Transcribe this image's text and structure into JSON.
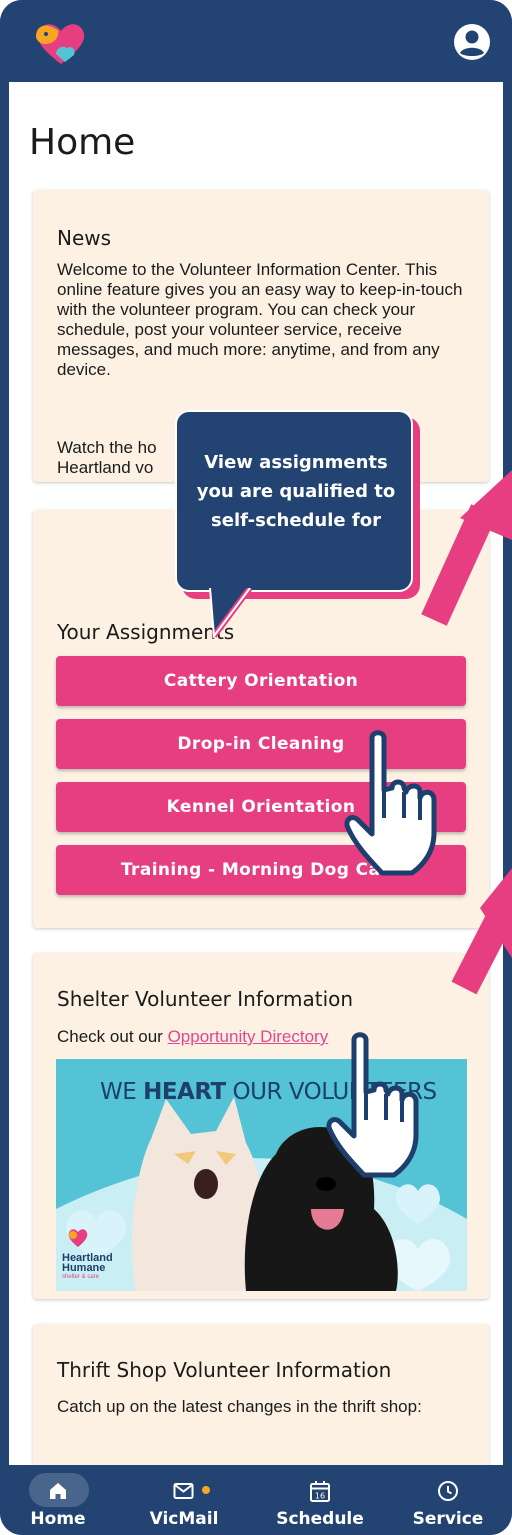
{
  "app": {
    "page_title": "Home",
    "colors": {
      "header": "#234473",
      "accent": "#e63e81",
      "card": "#fcf1e3"
    }
  },
  "header": {
    "logo_icon": "heartland-heart-logo-icon",
    "profile_icon": "account-circle-icon"
  },
  "news": {
    "title": "News",
    "body": "Welcome to the Volunteer Information Center. This online feature gives you an easy way to keep-in-touch with the volunteer program. You can check your schedule, post your volunteer service, receive messages, and much more: anytime, and from any device.",
    "watch_line1": "Watch the ho",
    "watch_line2": "Heartland vo"
  },
  "tooltip": {
    "text": "View assignments you are qualified to self-schedule for"
  },
  "assignments": {
    "title": "Your Assignments",
    "buttons": [
      "Cattery Orientation",
      "Drop-in Cleaning",
      "Kennel Orientation",
      "Training - Morning Dog Care"
    ]
  },
  "shelter": {
    "title": "Shelter Volunteer Information",
    "intro": "Check out our",
    "link": "Opportunity Directory",
    "banner": {
      "text_pre": "WE ",
      "text_bold": "HEART",
      "text_post": " OUR VOLUNTEERS",
      "logo_line1": "Heartland",
      "logo_line2": "Humane",
      "logo_line3": "shelter & care"
    }
  },
  "thrift": {
    "title": "Thrift Shop Volunteer Information",
    "body": "Catch up on the latest changes in the thrift shop:"
  },
  "bottom_nav": [
    {
      "label": "Home",
      "icon": "home-icon",
      "active": true
    },
    {
      "label": "VicMail",
      "icon": "mail-icon",
      "badge": true
    },
    {
      "label": "Schedule",
      "icon": "calendar-icon",
      "day": "16"
    },
    {
      "label": "Service",
      "icon": "clock-icon"
    }
  ]
}
